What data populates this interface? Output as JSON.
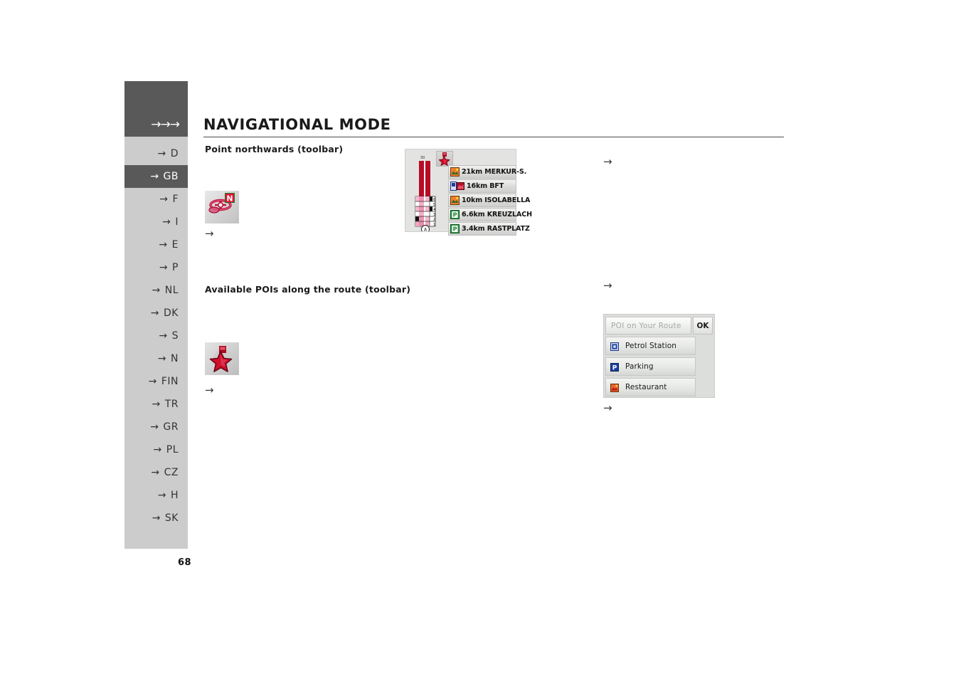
{
  "document": {
    "page_number": "68",
    "header_arrows": "→→→",
    "title": "NAVIGATIONAL MODE"
  },
  "sidebar": {
    "items": [
      {
        "label": "D",
        "active": false
      },
      {
        "label": "GB",
        "active": true
      },
      {
        "label": "F",
        "active": false
      },
      {
        "label": "I",
        "active": false
      },
      {
        "label": "E",
        "active": false
      },
      {
        "label": "P",
        "active": false
      },
      {
        "label": "NL",
        "active": false
      },
      {
        "label": "DK",
        "active": false
      },
      {
        "label": "S",
        "active": false
      },
      {
        "label": "N",
        "active": false
      },
      {
        "label": "FIN",
        "active": false
      },
      {
        "label": "TR",
        "active": false
      },
      {
        "label": "GR",
        "active": false
      },
      {
        "label": "PL",
        "active": false
      },
      {
        "label": "CZ",
        "active": false
      },
      {
        "label": "H",
        "active": false
      },
      {
        "label": "SK",
        "active": false
      }
    ],
    "arrow_glyph": "→"
  },
  "sections": {
    "northwards": {
      "heading": "Point northwards (toolbar)",
      "icon_name": "point-northwards-toolbar-icon",
      "arrow": "→"
    },
    "pois": {
      "heading": "Available POIs along the route (toolbar)",
      "icon_name": "available-pois-toolbar-icon",
      "arrow": "→"
    }
  },
  "arrows": {
    "right_top": "→",
    "right_mid": "→",
    "right_bottom": "→"
  },
  "navshot": {
    "toolbar_icon_name": "poi-star-toolbar-icon",
    "compass_label": "A",
    "segment_numbers": [
      "6",
      "5",
      "4",
      "3",
      "2",
      "1"
    ],
    "route_items": [
      {
        "icon": "scenic-poi-icon",
        "text": "21km MERKUR-S."
      },
      {
        "icon": "petrol-poi-icon",
        "text": "16km BFT"
      },
      {
        "icon": "scenic-poi-icon",
        "text": "10km ISOLABELLA"
      },
      {
        "icon": "parking-poi-icon",
        "text": "6.6km KREUZLACH"
      },
      {
        "icon": "parking-poi-icon",
        "text": "3.4km RASTPLATZ"
      }
    ]
  },
  "poi_dialog": {
    "field_placeholder": "POI on Your Route",
    "field_value": "",
    "ok_label": "OK",
    "items": [
      {
        "icon": "petrol-station-icon",
        "label": "Petrol Station"
      },
      {
        "icon": "parking-icon",
        "label": "Parking"
      },
      {
        "icon": "restaurant-icon",
        "label": "Restaurant"
      }
    ]
  },
  "colors": {
    "sidebar_bg": "#cccccc",
    "sidebar_active": "#595959",
    "header_bg": "#595959",
    "accent_red": "#c2103a"
  }
}
